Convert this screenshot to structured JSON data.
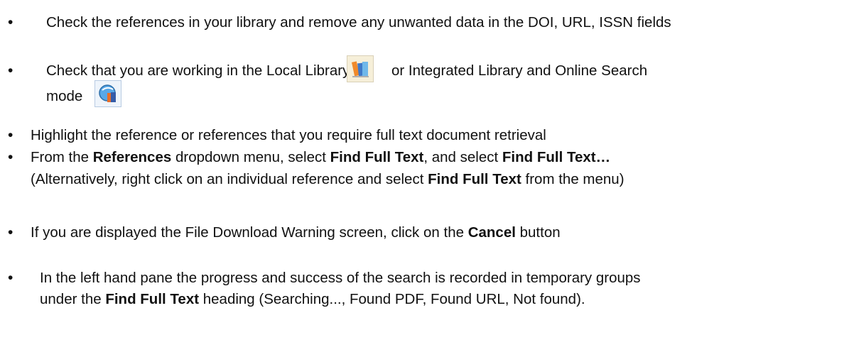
{
  "items": [
    {
      "text": "Check the references in your library and remove any unwanted data in the DOI, URL, ISSN fields"
    },
    {
      "text_a": "Check that you are working  in the Local Library",
      "text_b": "or Integrated Library and Online Search",
      "text_c": "mode"
    },
    {
      "text": "Highlight the reference or references that you require full text document retrieval"
    },
    {
      "a": "From the ",
      "b": "References",
      "c": " dropdown menu, select ",
      "d": "Find Full Text",
      "e": ", and select ",
      "f": "Find Full Text…",
      "g": "(Alternatively, right click on an individual reference and select ",
      "h": "Find Full Text",
      "i": " from the menu)"
    },
    {
      "a": "If you are displayed the File Download Warning screen, click on the ",
      "b": "Cancel",
      "c": " button"
    },
    {
      "a": "In the left hand pane the progress and success of the search is recorded in temporary groups",
      "b": "under the ",
      "c": "Find Full Text",
      "d": " heading (Searching..., Found PDF, Found URL, Not found)."
    }
  ],
  "icons": [
    "local-library-icon",
    "online-search-icon"
  ]
}
